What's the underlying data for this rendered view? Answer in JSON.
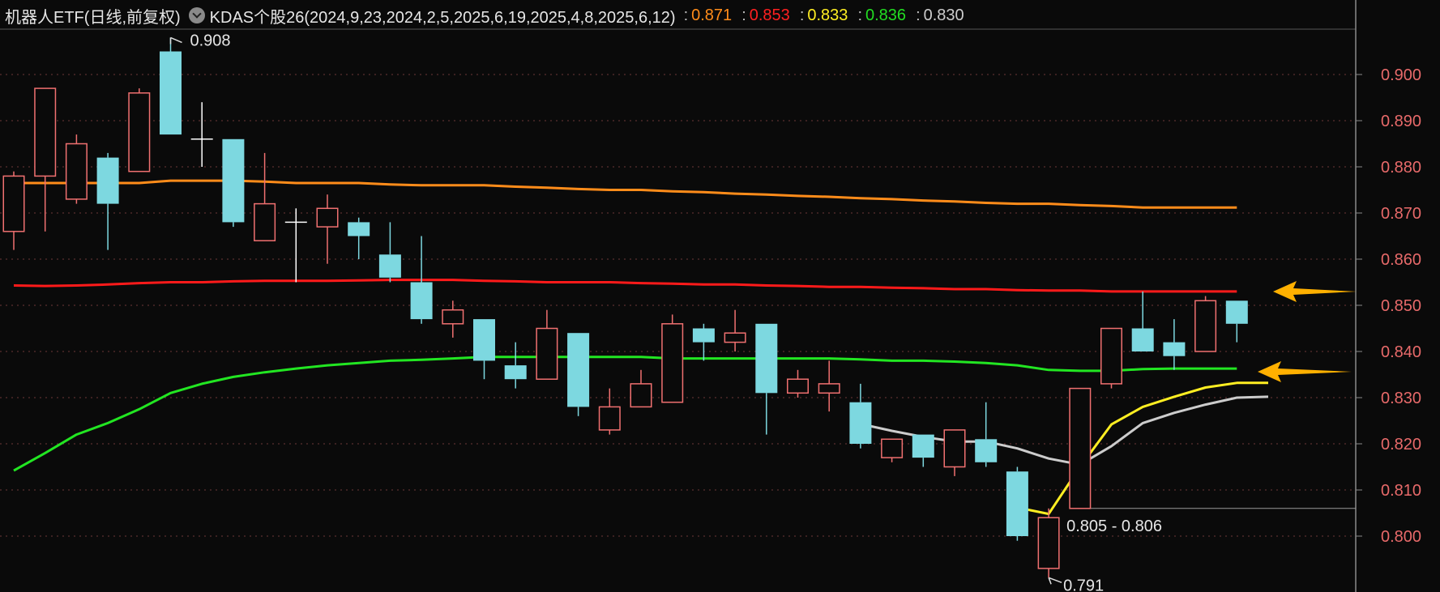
{
  "header": {
    "symbol": "机器人ETF",
    "period": "(日线,前复权)",
    "indicator": "KDAS个股26(2024,9,23,2024,2,5,2025,6,19,2025,4,8,2025,6,12)",
    "values": [
      {
        "text": "0.871",
        "color": "#ff8c1a"
      },
      {
        "text": "0.853",
        "color": "#ff2020"
      },
      {
        "text": "0.833",
        "color": "#ffee22"
      },
      {
        "text": "0.836",
        "color": "#22dd22"
      },
      {
        "text": "0.830",
        "color": "#cccccc"
      }
    ]
  },
  "chart_data": {
    "type": "candlestick",
    "ylim": [
      0.79,
      0.912
    ],
    "y_ticks": [
      "0.900",
      "0.890",
      "0.880",
      "0.870",
      "0.860",
      "0.850",
      "0.840",
      "0.830",
      "0.820",
      "0.810",
      "0.800"
    ],
    "tick_values": [
      0.9,
      0.89,
      0.88,
      0.87,
      0.86,
      0.85,
      0.84,
      0.83,
      0.82,
      0.81,
      0.8
    ],
    "candles": [
      {
        "o": 0.866,
        "h": 0.879,
        "l": 0.862,
        "c": 0.878
      },
      {
        "o": 0.878,
        "h": 0.897,
        "l": 0.866,
        "c": 0.897
      },
      {
        "o": 0.873,
        "h": 0.887,
        "l": 0.872,
        "c": 0.885
      },
      {
        "o": 0.882,
        "h": 0.883,
        "l": 0.862,
        "c": 0.872
      },
      {
        "o": 0.879,
        "h": 0.897,
        "l": 0.879,
        "c": 0.896
      },
      {
        "o": 0.905,
        "h": 0.908,
        "l": 0.887,
        "c": 0.887
      },
      {
        "o": 0.886,
        "h": 0.894,
        "l": 0.88,
        "c": 0.886
      },
      {
        "o": 0.886,
        "h": 0.886,
        "l": 0.867,
        "c": 0.868
      },
      {
        "o": 0.864,
        "h": 0.883,
        "l": 0.864,
        "c": 0.872
      },
      {
        "o": 0.868,
        "h": 0.871,
        "l": 0.855,
        "c": 0.868
      },
      {
        "o": 0.867,
        "h": 0.874,
        "l": 0.859,
        "c": 0.871
      },
      {
        "o": 0.868,
        "h": 0.869,
        "l": 0.86,
        "c": 0.865
      },
      {
        "o": 0.861,
        "h": 0.868,
        "l": 0.855,
        "c": 0.856
      },
      {
        "o": 0.855,
        "h": 0.865,
        "l": 0.846,
        "c": 0.847
      },
      {
        "o": 0.846,
        "h": 0.851,
        "l": 0.843,
        "c": 0.849
      },
      {
        "o": 0.847,
        "h": 0.847,
        "l": 0.834,
        "c": 0.838
      },
      {
        "o": 0.837,
        "h": 0.842,
        "l": 0.832,
        "c": 0.834
      },
      {
        "o": 0.834,
        "h": 0.849,
        "l": 0.834,
        "c": 0.845
      },
      {
        "o": 0.844,
        "h": 0.844,
        "l": 0.826,
        "c": 0.828
      },
      {
        "o": 0.823,
        "h": 0.832,
        "l": 0.822,
        "c": 0.828
      },
      {
        "o": 0.828,
        "h": 0.836,
        "l": 0.828,
        "c": 0.833
      },
      {
        "o": 0.829,
        "h": 0.848,
        "l": 0.829,
        "c": 0.846
      },
      {
        "o": 0.845,
        "h": 0.846,
        "l": 0.838,
        "c": 0.842
      },
      {
        "o": 0.842,
        "h": 0.849,
        "l": 0.84,
        "c": 0.844
      },
      {
        "o": 0.846,
        "h": 0.846,
        "l": 0.822,
        "c": 0.831
      },
      {
        "o": 0.831,
        "h": 0.836,
        "l": 0.83,
        "c": 0.834
      },
      {
        "o": 0.831,
        "h": 0.838,
        "l": 0.827,
        "c": 0.833
      },
      {
        "o": 0.829,
        "h": 0.833,
        "l": 0.819,
        "c": 0.82
      },
      {
        "o": 0.817,
        "h": 0.821,
        "l": 0.816,
        "c": 0.821
      },
      {
        "o": 0.822,
        "h": 0.822,
        "l": 0.815,
        "c": 0.817
      },
      {
        "o": 0.815,
        "h": 0.823,
        "l": 0.813,
        "c": 0.823
      },
      {
        "o": 0.821,
        "h": 0.829,
        "l": 0.815,
        "c": 0.816
      },
      {
        "o": 0.814,
        "h": 0.815,
        "l": 0.799,
        "c": 0.8
      },
      {
        "o": 0.793,
        "h": 0.806,
        "l": 0.791,
        "c": 0.804
      },
      {
        "o": 0.806,
        "h": 0.832,
        "l": 0.806,
        "c": 0.832
      },
      {
        "o": 0.833,
        "h": 0.845,
        "l": 0.832,
        "c": 0.845
      },
      {
        "o": 0.845,
        "h": 0.853,
        "l": 0.84,
        "c": 0.84
      },
      {
        "o": 0.842,
        "h": 0.847,
        "l": 0.836,
        "c": 0.839
      },
      {
        "o": 0.84,
        "h": 0.852,
        "l": 0.84,
        "c": 0.851
      },
      {
        "o": 0.851,
        "h": 0.851,
        "l": 0.842,
        "c": 0.846
      }
    ],
    "series": [
      {
        "color": "#ff8c1a",
        "start": 0,
        "values": [
          0.8765,
          0.8765,
          0.8765,
          0.8765,
          0.8765,
          0.877,
          0.877,
          0.877,
          0.8768,
          0.8765,
          0.8765,
          0.8765,
          0.8762,
          0.876,
          0.876,
          0.876,
          0.8757,
          0.8755,
          0.8752,
          0.875,
          0.875,
          0.8747,
          0.8745,
          0.8742,
          0.874,
          0.8737,
          0.8735,
          0.8732,
          0.873,
          0.8727,
          0.8725,
          0.8722,
          0.872,
          0.872,
          0.8717,
          0.8715,
          0.8712,
          0.8712,
          0.8712,
          0.8712
        ]
      },
      {
        "color": "#ff1a1a",
        "start": 0,
        "values": [
          0.8543,
          0.8542,
          0.8543,
          0.8545,
          0.8548,
          0.855,
          0.855,
          0.8552,
          0.8553,
          0.8553,
          0.8553,
          0.8554,
          0.8555,
          0.8555,
          0.8555,
          0.8553,
          0.8552,
          0.855,
          0.855,
          0.855,
          0.8548,
          0.8547,
          0.8545,
          0.8545,
          0.8543,
          0.8542,
          0.854,
          0.854,
          0.8538,
          0.8537,
          0.8535,
          0.8535,
          0.8533,
          0.8532,
          0.8532,
          0.853,
          0.853,
          0.853,
          0.853,
          0.853
        ]
      },
      {
        "color": "#22e622",
        "start": 0,
        "values": [
          0.8142,
          0.818,
          0.822,
          0.8245,
          0.8275,
          0.831,
          0.833,
          0.8345,
          0.8355,
          0.8363,
          0.837,
          0.8375,
          0.838,
          0.8382,
          0.8385,
          0.8388,
          0.8388,
          0.8388,
          0.8388,
          0.8388,
          0.8388,
          0.8385,
          0.8385,
          0.8385,
          0.8385,
          0.8385,
          0.8385,
          0.8383,
          0.838,
          0.838,
          0.8378,
          0.8375,
          0.837,
          0.836,
          0.8358,
          0.8358,
          0.8362,
          0.8363,
          0.8363,
          0.8363
        ]
      },
      {
        "color": "#cccccc",
        "start": 27,
        "values": [
          0.8243,
          0.8228,
          0.8215,
          0.8205,
          0.8205,
          0.819,
          0.8168,
          0.8155,
          0.8195,
          0.8245,
          0.8267,
          0.8285,
          0.83,
          0.8302
        ]
      },
      {
        "color": "#ffee22",
        "start": 32,
        "values": [
          0.8062,
          0.8048,
          0.815,
          0.8242,
          0.828,
          0.8302,
          0.8322,
          0.8332,
          0.8332
        ]
      }
    ],
    "annotations": [
      {
        "label": "0.908",
        "candle": 5,
        "value": 0.908,
        "side": "top"
      },
      {
        "label": "0.791",
        "candle": 33,
        "value": 0.791,
        "side": "bottom"
      },
      {
        "label": "0.805 - 0.806",
        "candle": 33,
        "value": 0.806,
        "side": "right"
      }
    ],
    "hline": 0.806
  }
}
